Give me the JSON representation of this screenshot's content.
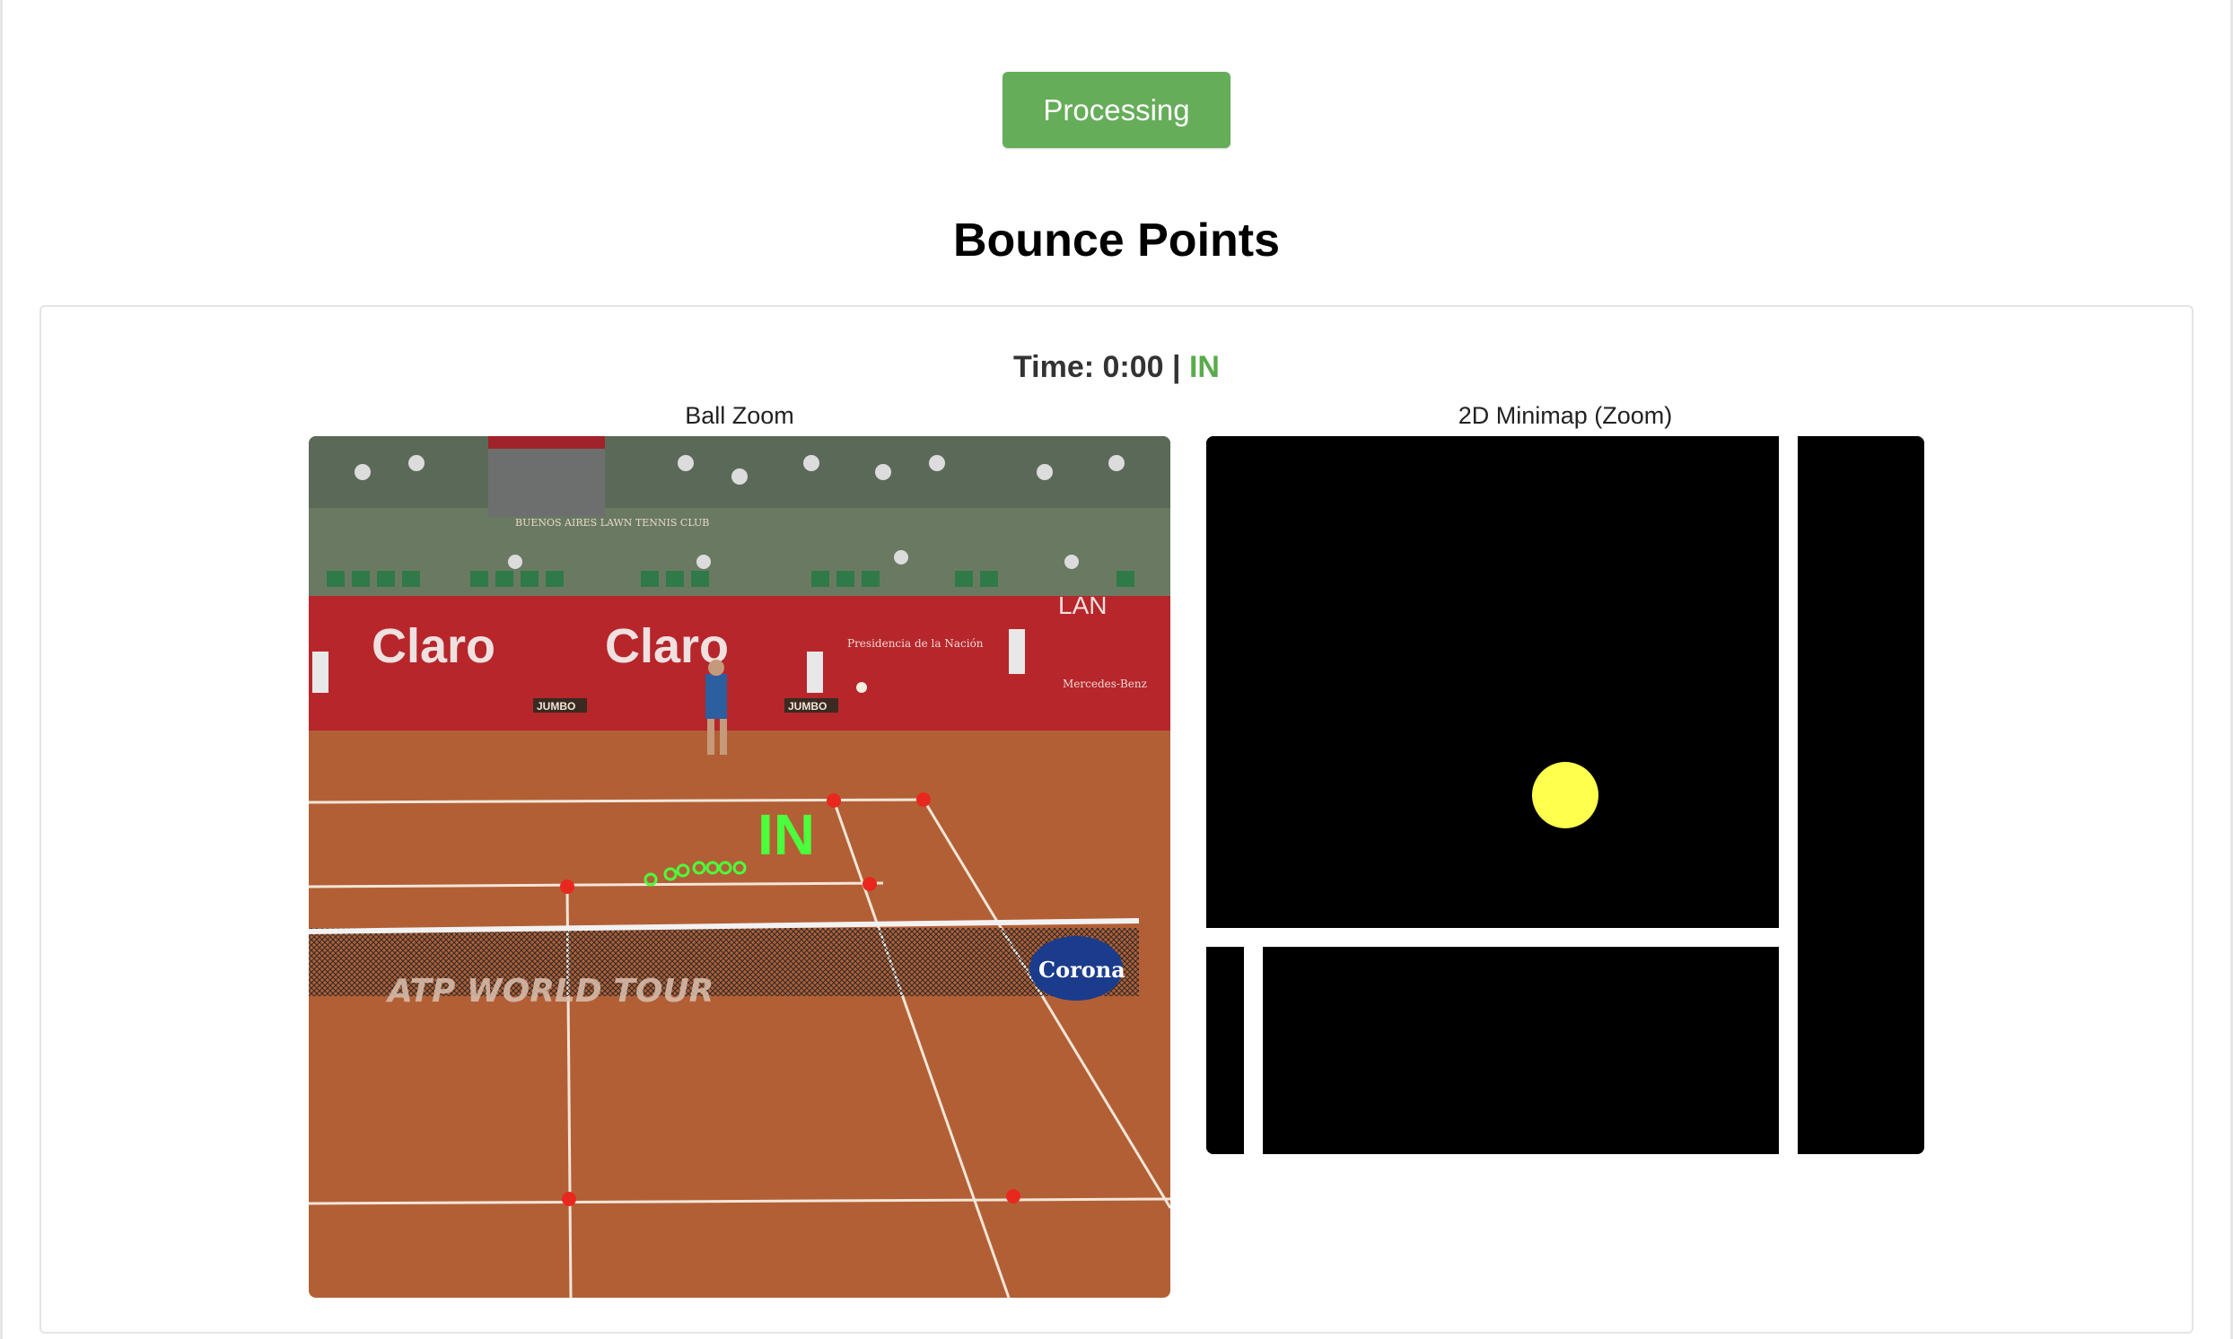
{
  "toolbar": {
    "process_button_label": "Processing"
  },
  "heading": {
    "title": "Bounce Points"
  },
  "bounce_card": {
    "time_prefix": "Time: 0:00 | ",
    "status": "IN",
    "status_color": "#5aab4c",
    "ball_zoom": {
      "label": "Ball Zoom",
      "overlay_call": "IN",
      "banner_texts": [
        "Claro",
        "Claro",
        "LAN",
        "JUMBO",
        "JUMBO",
        "Presidencia de la Nación",
        "Mercedes-Benz",
        "BUENOS AIRES LAWN TENNIS CLUB",
        "ATP WORLD TOUR",
        "Corona"
      ]
    },
    "minimap": {
      "label": "2D Minimap (Zoom)",
      "ball_color": "#ffff4d"
    }
  },
  "colors": {
    "button": "#66ad5a",
    "court_clay": "#b25f36",
    "court_keypoint": "#e8281e",
    "trajectory": "#4cff3c"
  }
}
